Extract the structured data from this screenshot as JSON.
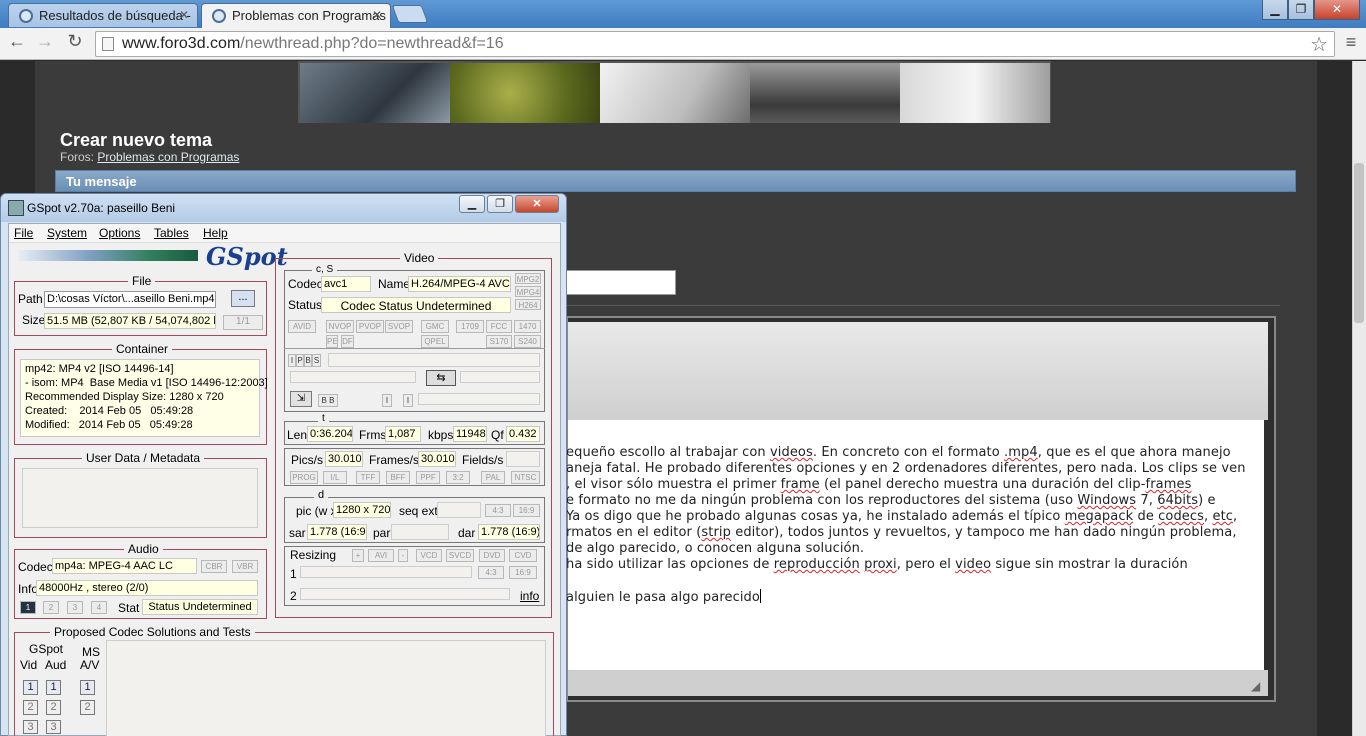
{
  "browser": {
    "tabs": [
      {
        "label": "Resultados de búsqueda -",
        "active": false
      },
      {
        "label": "Problemas con Programas",
        "active": true
      }
    ],
    "window_controls": {
      "minimize": "▁",
      "maximize": "❐",
      "close": "✕"
    },
    "url_domain": "www.foro3d.com",
    "url_path": "/newthread.php?do=newthread&f=16",
    "nav": {
      "back": "←",
      "forward": "→",
      "reload": "↻",
      "star": "☆",
      "menu": "≡"
    }
  },
  "page": {
    "title": "Crear nuevo tema",
    "forums_label": "Foros:",
    "forums_link": "Problemas con Programas",
    "message_header": "Tu mensaje",
    "message_lines": [
      {
        "segments": [
          {
            "t": "equeño escollo al trabajar con "
          },
          {
            "t": "videos",
            "sq": true
          },
          {
            "t": ". En concreto con el formato "
          },
          {
            "t": ".mp4",
            "sq": true
          },
          {
            "t": ", que es el que ahora manejo"
          }
        ]
      },
      {
        "segments": [
          {
            "t": "aneja fatal. He probado diferentes opciones y en 2 ordenadores diferentes, pero nada. Los clips se ven"
          }
        ]
      },
      {
        "segments": [
          {
            "t": ", el visor sólo muestra el primer "
          },
          {
            "t": "frame",
            "sq": true
          },
          {
            "t": " (el panel derecho muestra una duración del clip-"
          },
          {
            "t": "frames",
            "sq": true
          }
        ]
      },
      {
        "segments": [
          {
            "t": "e formato no me da ningún problema con los reproductores del sistema (uso "
          },
          {
            "t": "Windows",
            "sq": true
          },
          {
            "t": " 7, "
          },
          {
            "t": "64bits",
            "sq": true
          },
          {
            "t": ") e"
          }
        ]
      },
      {
        "segments": [
          {
            "t": "Ya os digo que he probado algunas cosas ya, he instalado además el típico "
          },
          {
            "t": "megapack",
            "sq": true
          },
          {
            "t": " de "
          },
          {
            "t": "codecs",
            "sq": true
          },
          {
            "t": ", "
          },
          {
            "t": "etc",
            "sq": true
          },
          {
            "t": ","
          }
        ]
      },
      {
        "segments": [
          {
            "t": "rmatos en el editor ("
          },
          {
            "t": "strip",
            "sq": true
          },
          {
            "t": " editor), todos juntos y revueltos, y tampoco me han dado ningún problema,"
          }
        ]
      },
      {
        "segments": [
          {
            "t": " de algo parecido, o conocen alguna solución."
          }
        ]
      },
      {
        "segments": [
          {
            "t": " ha sido utilizar las opciones de "
          },
          {
            "t": "reproducción",
            "sq": true
          },
          {
            "t": " "
          },
          {
            "t": "proxi",
            "sq": true
          },
          {
            "t": ", pero el "
          },
          {
            "t": "video",
            "sq": true
          },
          {
            "t": " sigue sin mostrar la duración"
          }
        ]
      },
      {
        "segments": [
          {
            "t": ""
          }
        ]
      },
      {
        "segments": [
          {
            "t": "alguien le pasa algo parecido"
          }
        ]
      }
    ]
  },
  "gspot": {
    "title": "GSpot v2.70a: paseillo Beni",
    "menu": [
      "File",
      "System",
      "Options",
      "Tables",
      "Help"
    ],
    "logo": "GSpot",
    "file": {
      "legend": "File",
      "path_label": "Path",
      "path_value": "D:\\cosas Víctor\\...aseillo Beni.mp4",
      "browse_label": "...",
      "size_label": "Size",
      "size_value": "51.5 MB (52,807 KB / 54,074,802 b.",
      "count": "1/1"
    },
    "container": {
      "legend": "Container",
      "text": "mp42: MP4 v2 [ISO 14496-14]\n- isom: MP4  Base Media v1 [ISO 14496-12:2003]\nRecommended Display Size: 1280 x 720\nCreated:    2014 Feb 05   05:49:28\nModified:   2014 Feb 05   05:49:28"
    },
    "userdata": {
      "legend": "User Data / Metadata"
    },
    "audio": {
      "legend": "Audio",
      "codec_label": "Codec",
      "codec_value": "mp4a: MPEG-4 AAC LC",
      "cbr": "CBR",
      "vbr": "VBR",
      "info_label": "Info",
      "info_value": "48000Hz  , stereo (2/0)",
      "tracks": [
        "1",
        "2",
        "3",
        "4"
      ],
      "stat_label": "Stat",
      "stat_value": "Status Undetermined"
    },
    "video": {
      "legend": "Video",
      "cs_legend": "c, S",
      "codec_label": "Codec",
      "codec_value": "avc1",
      "name_label": "Name",
      "name_value": "H.264/MPEG-4 AVC",
      "side_tags": [
        "MPG2",
        "MPG4",
        "H264"
      ],
      "status_label": "Status",
      "status_value": "Codec Status Undetermined",
      "flags_row1": [
        "AVID",
        "NVOP",
        "PVOP",
        "SVOP",
        "GMC",
        "1709",
        "FCC",
        "1470"
      ],
      "flags_row2": [
        "PE",
        "DF",
        "QPEL",
        "S170",
        "S240"
      ],
      "frame_tags": [
        "I",
        "P",
        "B",
        "S"
      ],
      "t_legend": "t",
      "len_label": "Len",
      "len_value": "0:36.204",
      "frms_label": "Frms",
      "frms_value": "1,087",
      "kbps_label": "kbps",
      "kbps_value": "11948",
      "qf_label": "Qf",
      "qf_value": "0.432",
      "pics_label": "Pics/s",
      "pics_value": "30.010",
      "frames_label": "Frames/s",
      "frames_value": "30.010",
      "fields_label": "Fields/s",
      "flags_row3": [
        "PROG",
        "I/L",
        "TFF",
        "BFF",
        "PPF",
        "3:2",
        "PAL",
        "NTSC"
      ],
      "d_legend": "d",
      "pic_label": "pic (w x",
      "pic_value": "1280 x 720",
      "seqext_label": "seq ext",
      "ratio_tags": [
        "4:3",
        "16:9"
      ],
      "sar_label": "sar",
      "sar_value": "1.778 (16:9)",
      "par_label": "par",
      "dar_label": "dar",
      "dar_value": "1.778 (16:9)",
      "resizing_label": "Resizing",
      "resize_tags": [
        "+",
        "AVI",
        "-",
        "VCD",
        "SVCD",
        "DVD",
        "CVD"
      ],
      "r1": "1",
      "r2": "2",
      "info_link": "info"
    },
    "proposed": {
      "legend": "Proposed Codec Solutions and Tests",
      "gspot_label": "GSpot",
      "vid_label": "Vid",
      "aud_label": "Aud",
      "ms_label": "MS",
      "av_label": "A/V",
      "buttons": [
        "1",
        "2",
        "3"
      ]
    }
  }
}
